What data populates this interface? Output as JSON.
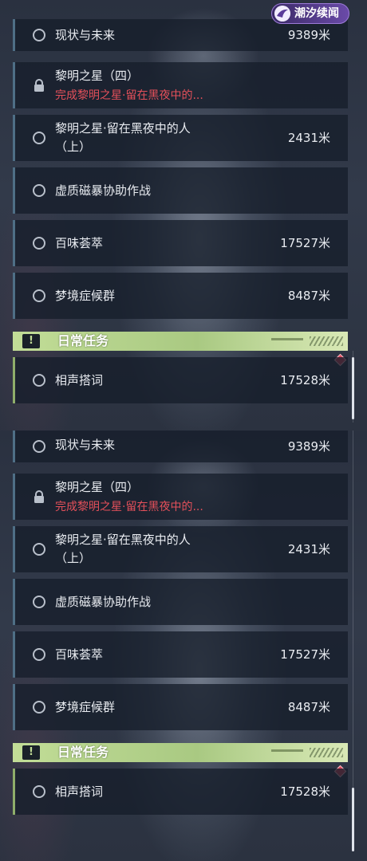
{
  "logo": {
    "text": "潮汐续闻"
  },
  "panels": [
    {
      "quests": [
        {
          "title": "现状与未来",
          "distance": "9389米"
        },
        {
          "title": "黎明之星（四）",
          "subtitle": "完成黎明之星·留在黑夜中的..."
        },
        {
          "title_line1": "黎明之星·留在黑夜中的人",
          "title_line2": "（上）",
          "distance": "2431米"
        },
        {
          "title": "虚质磁暴协助作战"
        },
        {
          "title": "百味荟萃",
          "distance": "17527米"
        },
        {
          "title": "梦境症候群",
          "distance": "8487米"
        }
      ],
      "daily_section": {
        "label": "日常任务",
        "icon_glyph": "!",
        "quest": {
          "title": "相声搭词",
          "distance": "17528米"
        }
      }
    },
    {
      "quests": [
        {
          "title": "现状与未来",
          "distance": "9389米"
        },
        {
          "title": "黎明之星（四）",
          "subtitle": "完成黎明之星·留在黑夜中的..."
        },
        {
          "title_line1": "黎明之星·留在黑夜中的人",
          "title_line2": "（上）",
          "distance": "2431米"
        },
        {
          "title": "虚质磁暴协助作战"
        },
        {
          "title": "百味荟萃",
          "distance": "17527米"
        },
        {
          "title": "梦境症候群",
          "distance": "8487米"
        }
      ],
      "daily_section": {
        "label": "日常任务",
        "icon_glyph": "!",
        "quest": {
          "title": "相声搭词",
          "distance": "17528米"
        }
      }
    }
  ],
  "colors": {
    "accent_green": "#c2dd97",
    "locked_subtitle": "#e4505a",
    "quest_bar": "#4f6f86",
    "new_marker": "#e0455a"
  }
}
